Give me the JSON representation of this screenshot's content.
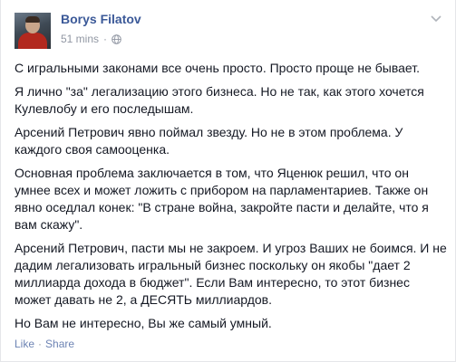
{
  "post": {
    "author": "Borys Filatov",
    "time": "51 mins",
    "meta_separator": "·",
    "paragraphs": [
      "С игральными законами все очень просто. Просто проще не бывает.",
      "Я лично \"за\" легализацию этого бизнеса. Но не так, как этого хочется Кулевлобу и его последышам.",
      "Арсений Петрович явно поймал звезду. Но не в этом проблема. У каждого своя самооценка.",
      "Основная проблема заключается в том, что Яценюк решил, что он умнее всех и может ложить с прибором на парламентариев. Также он явно оседлал конек: \"В стране война, закройте пасти и делайте, что я вам скажу\".",
      "Арсений Петрович, пасти мы не закроем. И угроз Ваших не боимся. И не дадим легализовать игральный бизнес поскольку он якобы \"дает 2 миллиарда дохода в бюджет\". Если Вам интересно, то этот бизнес может давать не 2, а ДЕСЯТЬ миллиардов.",
      "Но Вам не интересно, Вы же самый умный."
    ],
    "actions": {
      "like": "Like",
      "separator": "·",
      "share": "Share"
    }
  },
  "icons": {
    "privacy": "globe-icon",
    "options": "chevron-down-icon"
  },
  "colors": {
    "link": "#3b5998",
    "action": "#6d84b4",
    "meta": "#9197a3",
    "text": "#141823"
  }
}
